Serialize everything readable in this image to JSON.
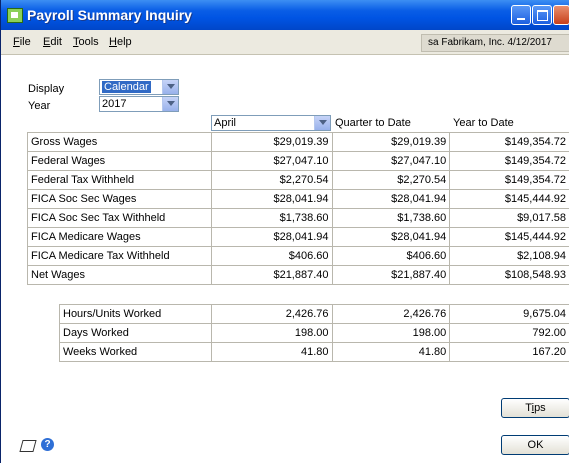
{
  "window": {
    "title": "Payroll Summary Inquiry",
    "context": "sa  Fabrikam, Inc.  4/12/2017"
  },
  "menu": [
    {
      "accel": "F",
      "rest": "ile"
    },
    {
      "accel": "E",
      "rest": "dit"
    },
    {
      "accel": "T",
      "rest": "ools"
    },
    {
      "accel": "H",
      "rest": "elp"
    }
  ],
  "filters": {
    "display_label": "Display",
    "display_value": "Calendar",
    "year_label": "Year",
    "year_value": "2017"
  },
  "columns": {
    "period_value": "April",
    "qtd": "Quarter to Date",
    "ytd": "Year to Date"
  },
  "wages_rows": [
    {
      "label": "Gross Wages",
      "period": "$29,019.39",
      "qtd": "$29,019.39",
      "ytd": "$149,354.72"
    },
    {
      "label": "Federal Wages",
      "period": "$27,047.10",
      "qtd": "$27,047.10",
      "ytd": "$149,354.72"
    },
    {
      "label": "Federal Tax Withheld",
      "period": "$2,270.54",
      "qtd": "$2,270.54",
      "ytd": "$149,354.72"
    },
    {
      "label": "FICA Soc Sec Wages",
      "period": "$28,041.94",
      "qtd": "$28,041.94",
      "ytd": "$145,444.92"
    },
    {
      "label": "FICA Soc Sec Tax Withheld",
      "period": "$1,738.60",
      "qtd": "$1,738.60",
      "ytd": "$9,017.58"
    },
    {
      "label": "FICA Medicare Wages",
      "period": "$28,041.94",
      "qtd": "$28,041.94",
      "ytd": "$145,444.92"
    },
    {
      "label": "FICA Medicare Tax Withheld",
      "period": "$406.60",
      "qtd": "$406.60",
      "ytd": "$2,108.94"
    },
    {
      "label": "Net Wages",
      "period": "$21,887.40",
      "qtd": "$21,887.40",
      "ytd": "$108,548.93"
    }
  ],
  "hours_rows": [
    {
      "label": "Hours/Units Worked",
      "period": "2,426.76",
      "qtd": "2,426.76",
      "ytd": "9,675.04"
    },
    {
      "label": "Days Worked",
      "period": "198.00",
      "qtd": "198.00",
      "ytd": "792.00"
    },
    {
      "label": "Weeks Worked",
      "period": "41.80",
      "qtd": "41.80",
      "ytd": "167.20"
    }
  ],
  "buttons": {
    "tips_accel": "i",
    "tips_pre": "T",
    "tips_post": "ps",
    "ok": "OK"
  },
  "icons": {
    "note": "note-icon",
    "help": "help-icon"
  }
}
